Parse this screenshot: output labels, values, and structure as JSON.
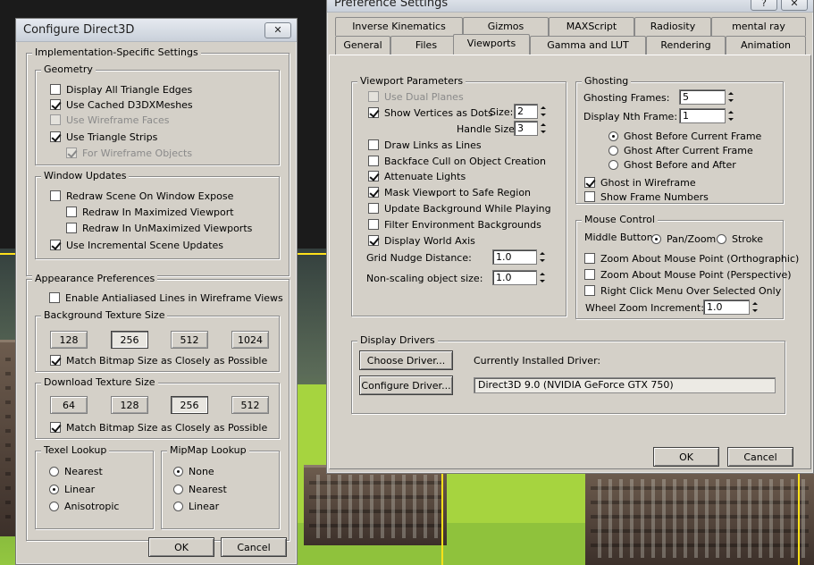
{
  "d3d": {
    "title": "Configure Direct3D",
    "close_glyph": "✕",
    "impl_title": "Implementation-Specific Settings",
    "geometry": {
      "title": "Geometry",
      "display_all_triangle_edges": "Display All Triangle Edges",
      "use_cached_d3dxmeshes": "Use Cached D3DXMeshes",
      "use_wireframe_faces": "Use Wireframe Faces",
      "use_triangle_strips": "Use Triangle Strips",
      "for_wireframe_objects": "For Wireframe Objects"
    },
    "window_updates": {
      "title": "Window Updates",
      "redraw_on_expose": "Redraw Scene On Window Expose",
      "redraw_maximized": "Redraw In Maximized Viewport",
      "redraw_unmaximized": "Redraw In UnMaximized Viewports",
      "incremental_updates": "Use Incremental Scene Updates"
    },
    "appearance_title": "Appearance Preferences",
    "antialiased_lines": "Enable Antialiased Lines in Wireframe Views",
    "bg_texture": {
      "title": "Background Texture Size",
      "sizes": [
        "128",
        "256",
        "512",
        "1024"
      ],
      "match": "Match Bitmap Size as Closely as Possible"
    },
    "dl_texture": {
      "title": "Download Texture Size",
      "sizes": [
        "64",
        "128",
        "256",
        "512"
      ],
      "match": "Match Bitmap Size as Closely as Possible"
    },
    "texel": {
      "title": "Texel Lookup",
      "nearest": "Nearest",
      "linear": "Linear",
      "anisotropic": "Anisotropic"
    },
    "mipmap": {
      "title": "MipMap Lookup",
      "none": "None",
      "nearest": "Nearest",
      "linear": "Linear"
    },
    "ok": "OK",
    "cancel": "Cancel"
  },
  "pref": {
    "title": "Preference Settings",
    "help_glyph": "?",
    "close_glyph": "✕",
    "tabs_row1": [
      "Inverse Kinematics",
      "Gizmos",
      "MAXScript",
      "Radiosity",
      "mental ray"
    ],
    "tabs_row2": [
      "General",
      "Files",
      "Viewports",
      "Gamma and LUT",
      "Rendering",
      "Animation"
    ],
    "viewport": {
      "title": "Viewport Parameters",
      "use_dual_planes": "Use Dual Planes",
      "show_vertices": "Show Vertices as Dots",
      "size_label": "Size:",
      "size_value": "2",
      "handle_size_label": "Handle Size:",
      "handle_size_value": "3",
      "draw_links": "Draw Links as Lines",
      "backface_cull": "Backface Cull on Object Creation",
      "attenuate_lights": "Attenuate Lights",
      "mask_viewport": "Mask Viewport to Safe Region",
      "update_bg": "Update Background While Playing",
      "filter_env": "Filter Environment Backgrounds",
      "display_world_axis": "Display World Axis",
      "grid_nudge_label": "Grid Nudge Distance:",
      "grid_nudge_value": "1.0",
      "nonscaling_label": "Non-scaling object size:",
      "nonscaling_value": "1.0"
    },
    "ghosting": {
      "title": "Ghosting",
      "frames_label": "Ghosting Frames:",
      "frames_value": "5",
      "nth_label": "Display Nth Frame:",
      "nth_value": "1",
      "before": "Ghost Before Current Frame",
      "after": "Ghost After Current Frame",
      "both": "Ghost Before and After",
      "in_wireframe": "Ghost in Wireframe",
      "show_numbers": "Show Frame Numbers"
    },
    "mouse": {
      "title": "Mouse Control",
      "middle_label": "Middle Button:",
      "pan_zoom": "Pan/Zoom",
      "stroke": "Stroke",
      "zoom_ortho": "Zoom About Mouse Point (Orthographic)",
      "zoom_persp": "Zoom About Mouse Point (Perspective)",
      "right_click": "Right Click Menu Over Selected Only",
      "wheel_label": "Wheel Zoom Increment:",
      "wheel_value": "1.0"
    },
    "drivers": {
      "title": "Display Drivers",
      "choose": "Choose Driver...",
      "configure": "Configure Driver...",
      "installed_label": "Currently Installed Driver:",
      "installed_value": "Direct3D 9.0 (NVIDIA GeForce GTX 750)"
    },
    "ok": "OK",
    "cancel": "Cancel"
  }
}
